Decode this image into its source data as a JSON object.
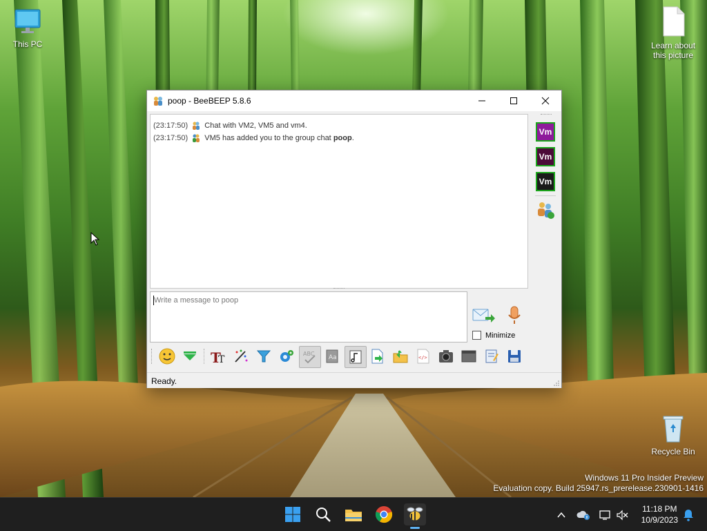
{
  "desktop": {
    "icons": {
      "this_pc": "This PC",
      "learn_about": "Learn about this picture",
      "recycle_bin": "Recycle Bin"
    },
    "watermark": {
      "line1": "Windows 11 Pro Insider Preview",
      "line2": "Evaluation copy. Build 25947.rs_prerelease.230901-1416"
    }
  },
  "window": {
    "title": "poop - BeeBEEP 5.8.6",
    "controls": [
      "minimize-icon",
      "maximize-icon",
      "close-icon"
    ],
    "chat": {
      "messages": [
        {
          "time": "(23:17:50)",
          "icon": "group-chat-icon",
          "text": "Chat with VM2, VM5 and vm4.",
          "bold": ""
        },
        {
          "time": "(23:17:50)",
          "icon": "add-user-icon",
          "text": "VM5 has added you to the group chat ",
          "bold": "poop",
          "suffix": "."
        }
      ]
    },
    "input": {
      "placeholder": "Write a message to poop",
      "value": ""
    },
    "minimize_label": "Minimize",
    "minimize_checked": false,
    "side_panel": {
      "users": [
        {
          "label": "Vm",
          "bg": "#8e1a9b"
        },
        {
          "label": "Vm",
          "bg": "#4b0a38"
        },
        {
          "label": "Vm",
          "bg": "#1a1a1a"
        }
      ],
      "group_icon": "group-users-icon"
    },
    "toolbar": [
      "emoticon-icon",
      "expand-icon",
      "font-icon",
      "color-icon",
      "filter-icon",
      "settings-icon",
      "spellcheck-icon",
      "dictionary-icon",
      "music-icon",
      "send-file-icon",
      "share-folder-icon",
      "html-icon",
      "screenshot-icon",
      "terminal-icon",
      "notes-icon",
      "save-icon"
    ],
    "status": "Ready."
  },
  "taskbar": {
    "icons": [
      "start-icon",
      "search-icon",
      "file-explorer-icon",
      "chrome-icon",
      "beebeep-icon"
    ],
    "tray_icons": [
      "chevron-up-icon",
      "onedrive-icon",
      "network-icon",
      "volume-mute-icon"
    ],
    "clock_time": "11:18 PM",
    "clock_date": "10/9/2023",
    "notification_icon": "bell-icon"
  },
  "colors": {
    "accent": "#0078d4",
    "taskbar": "#1f1f1f",
    "vm_border": "#1aa51a"
  }
}
